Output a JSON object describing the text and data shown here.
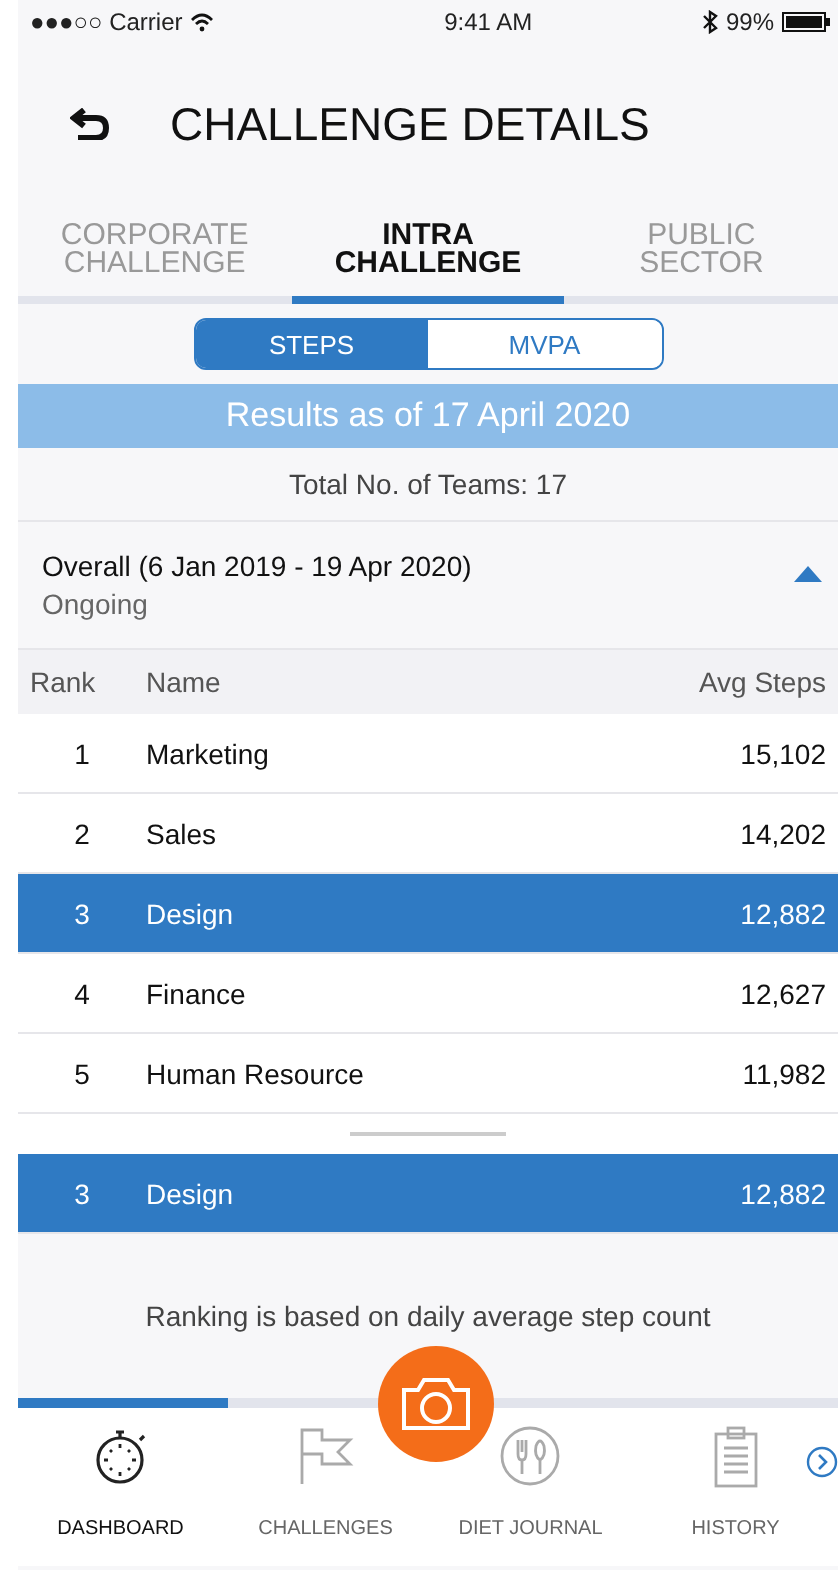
{
  "status_bar": {
    "carrier": "●●●○○ Carrier",
    "time": "9:41 AM",
    "battery": "99%"
  },
  "header": {
    "title": "CHALLENGE DETAILS"
  },
  "tabs": [
    {
      "label": "CORPORATE\nCHALLENGE",
      "selected": false
    },
    {
      "label": "INTRA\nCHALLENGE",
      "selected": true
    },
    {
      "label": "PUBLIC\nSECTOR",
      "selected": false
    }
  ],
  "segments": [
    {
      "label": "STEPS",
      "selected": true
    },
    {
      "label": "MVPA",
      "selected": false
    }
  ],
  "banner": "Results as of 17 April 2020",
  "total_teams": "Total No. of Teams: 17",
  "period": {
    "title": "Overall (6 Jan 2019 - 19 Apr 2020)",
    "status": "Ongoing",
    "expanded": true
  },
  "table": {
    "columns": [
      "Rank",
      "Name",
      "Avg Steps"
    ],
    "rows": [
      {
        "rank": "1",
        "name": "Marketing",
        "steps": "15,102",
        "selected": false
      },
      {
        "rank": "2",
        "name": "Sales",
        "steps": "14,202",
        "selected": false
      },
      {
        "rank": "3",
        "name": "Design",
        "steps": "12,882",
        "selected": true
      },
      {
        "rank": "4",
        "name": "Finance",
        "steps": "12,627",
        "selected": false
      },
      {
        "rank": "5",
        "name": "Human Resource",
        "steps": "11,982",
        "selected": false
      }
    ]
  },
  "my_team": {
    "rank": "3",
    "name": "Design",
    "steps": "12,882"
  },
  "footnote": "Ranking is based on daily average step count",
  "nav": [
    {
      "label": "DASHBOARD",
      "kind": "stopwatch",
      "selected": true
    },
    {
      "label": "CHALLENGES",
      "kind": "flag",
      "selected": false
    },
    {
      "label": "DIET JOURNAL",
      "kind": "cutlery",
      "selected": false
    },
    {
      "label": "HISTORY",
      "kind": "clipboard",
      "selected": false
    }
  ]
}
